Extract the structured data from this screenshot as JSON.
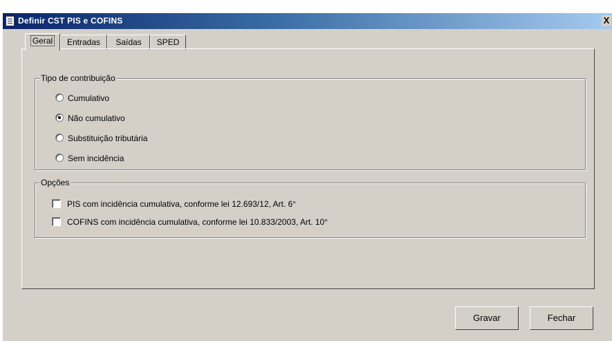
{
  "window": {
    "title": "Definir CST PIS e COFINS",
    "close_symbol": "X"
  },
  "tabs": [
    {
      "label": "Geral",
      "active": true
    },
    {
      "label": "Entradas",
      "active": false
    },
    {
      "label": "Saídas",
      "active": false
    },
    {
      "label": "SPED",
      "active": false
    }
  ],
  "tipo": {
    "legend": "Tipo de contribuição",
    "options": [
      {
        "label": "Cumulativo",
        "checked": false
      },
      {
        "label": "Não cumulativo",
        "checked": true
      },
      {
        "label": "Substituição tributária",
        "checked": false
      },
      {
        "label": "Sem incidência",
        "checked": false
      }
    ]
  },
  "opcoes": {
    "legend": "Opções",
    "items": [
      {
        "label": "PIS com incidência cumulativa, conforme lei 12.693/12, Art. 6°",
        "checked": false
      },
      {
        "label": "COFINS com incidência cumulativa, conforme lei 10.833/2003, Art. 10°",
        "checked": false
      }
    ]
  },
  "buttons": {
    "save": "Gravar",
    "close": "Fechar"
  }
}
